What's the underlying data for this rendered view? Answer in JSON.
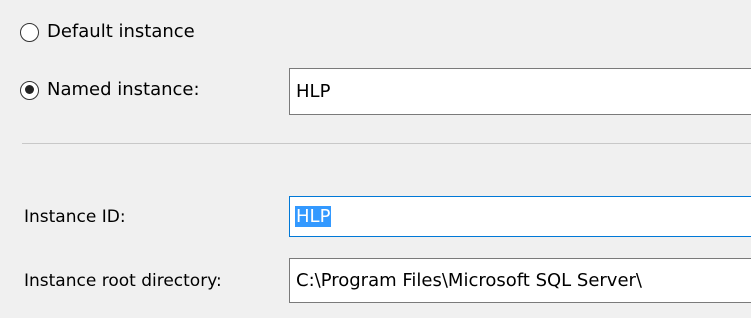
{
  "instance_options": {
    "default_label": "Default instance",
    "named_label": "Named instance:",
    "selected": "named",
    "named_value": "HLP"
  },
  "instance_id": {
    "label": "Instance ID:",
    "value": "HLP"
  },
  "root_directory": {
    "label": "Instance root directory:",
    "value": "C:\\Program Files\\Microsoft SQL Server\\"
  },
  "colors": {
    "background": "#f0f0f0",
    "selection": "#3399ff",
    "focus_border": "#0078d7"
  }
}
